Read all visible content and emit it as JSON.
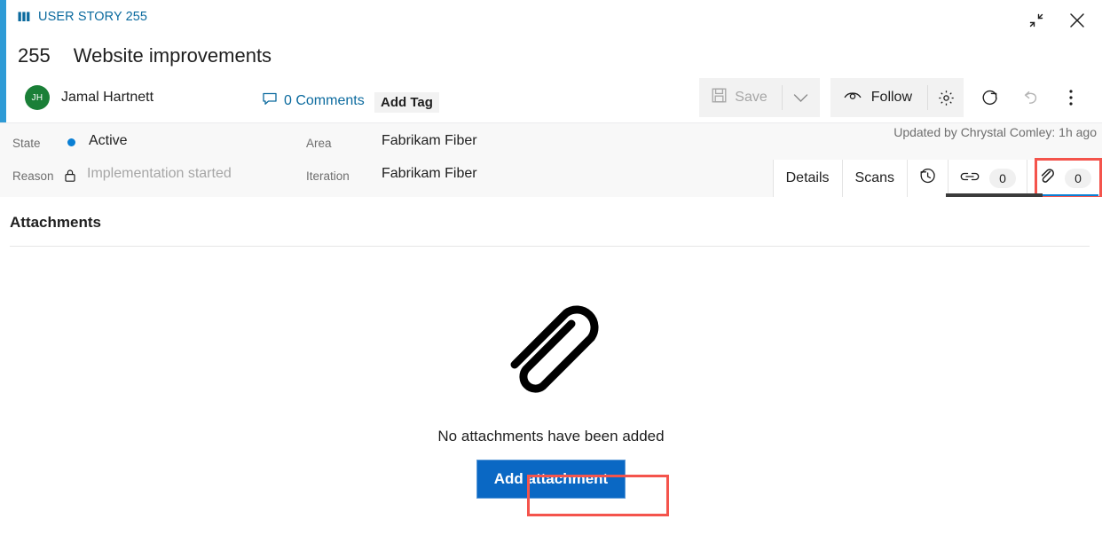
{
  "header": {
    "breadcrumb": "USER STORY 255",
    "breadcrumb_icon": "user-story-icon",
    "work_item_id": "255",
    "work_item_title": "Website improvements",
    "assignee": {
      "initials": "JH",
      "name": "Jamal Hartnett",
      "avatar_color": "#1a7f37"
    },
    "comments_label": "0 Comments",
    "add_tag_label": "Add Tag",
    "window_controls": {
      "restore_label": "restore-window-icon",
      "close_label": "close-icon"
    }
  },
  "toolbar": {
    "save_label": "Save",
    "save_enabled": "false",
    "save_dropdown_label": "chevron-down-icon",
    "follow_label": "Follow",
    "settings_label": "gear-icon",
    "refresh_label": "refresh-icon",
    "undo_label": "undo-icon",
    "more_label": "more-options-icon"
  },
  "fields": {
    "state_label": "State",
    "state_value": "Active",
    "state_color": "#0a7fd4",
    "reason_label": "Reason",
    "reason_value": "Implementation started",
    "reason_locked": "true",
    "area_label": "Area",
    "area_value": "Fabrikam Fiber",
    "iteration_label": "Iteration",
    "iteration_value": "Fabrikam Fiber",
    "updated_text": "Updated by Chrystal Comley: 1h ago"
  },
  "tabs": {
    "items": [
      {
        "label": "Details",
        "type": "text",
        "selected": "false"
      },
      {
        "label": "Scans",
        "type": "text",
        "selected": "false"
      },
      {
        "label": "history-icon",
        "type": "icon",
        "selected": "false"
      },
      {
        "label": "link-icon",
        "type": "icon-count",
        "count": "0",
        "selected": "false"
      },
      {
        "label": "attachment-icon",
        "type": "icon-count",
        "count": "0",
        "selected": "true"
      }
    ],
    "tooltip": "Attachments",
    "highlight_color": "#f4544c",
    "selected_underline_color": "#0a7fd4"
  },
  "content": {
    "section_title": "Attachments",
    "empty_icon": "paperclip-illustration",
    "empty_text": "No attachments have been added",
    "add_attachment_label": "Add attachment",
    "add_button_color": "#0a68c4"
  }
}
